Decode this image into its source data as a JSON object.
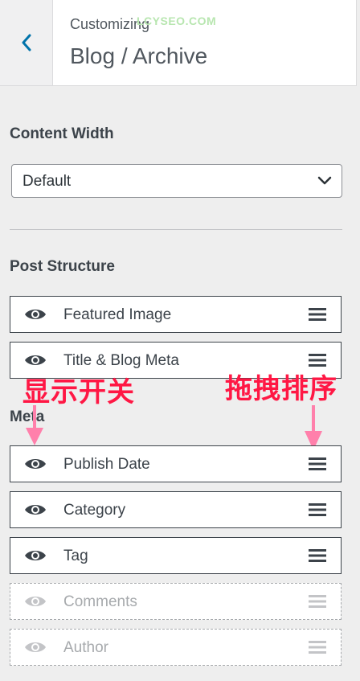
{
  "header": {
    "breadcrumb": "Customizing",
    "title": "Blog / Archive",
    "watermark": "LCYSEO.COM"
  },
  "content_width": {
    "heading": "Content Width",
    "selected": "Default"
  },
  "post_structure": {
    "heading": "Post Structure",
    "items": [
      {
        "label": "Featured Image",
        "visible": true
      },
      {
        "label": "Title & Blog Meta",
        "visible": true
      }
    ]
  },
  "meta": {
    "heading": "Meta",
    "items": [
      {
        "label": "Publish Date",
        "visible": true
      },
      {
        "label": "Category",
        "visible": true
      },
      {
        "label": "Tag",
        "visible": true
      },
      {
        "label": "Comments",
        "visible": false
      },
      {
        "label": "Author",
        "visible": false
      }
    ]
  },
  "annotations": {
    "toggle": "显示开关",
    "drag": "拖拽排序",
    "arrow_color": "#ff80ab"
  },
  "colors": {
    "accent": "#0073aa",
    "annotation": "#ff1744"
  }
}
